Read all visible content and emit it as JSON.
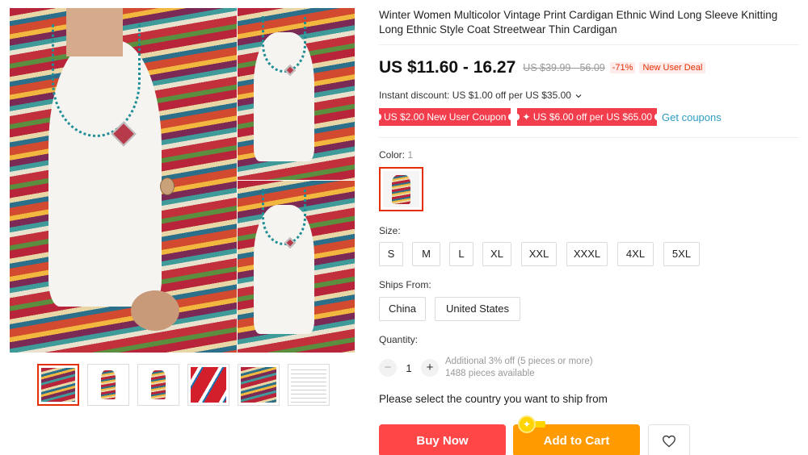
{
  "product": {
    "title": "Winter Women Multicolor Vintage Print Cardigan Ethnic Wind Long Sleeve Knitting Long Ethnic Style Coat Streetwear Thin Cardigan",
    "price": "US $11.60 - 16.27",
    "original_price": "US $39.99 - 56.09",
    "discount_percent": "-71%",
    "deal_badge": "New User Deal",
    "instant_discount": "Instant discount: US $1.00 off per US $35.00",
    "coupons": [
      "US $2.00 New User Coupon",
      "US $6.00 off per US $65.00"
    ],
    "get_coupons_label": "Get coupons"
  },
  "color": {
    "label": "Color:",
    "count": "1"
  },
  "size": {
    "label": "Size:",
    "options": [
      "S",
      "M",
      "L",
      "XL",
      "XXL",
      "XXXL",
      "4XL",
      "5XL"
    ]
  },
  "ships_from": {
    "label": "Ships From:",
    "options": [
      "China",
      "United States"
    ]
  },
  "quantity": {
    "label": "Quantity:",
    "minus": "−",
    "plus": "+",
    "value": "1",
    "bulk_note": "Additional 3% off (5 pieces or more)",
    "available": "1488 pieces available"
  },
  "ship_message": "Please select the country you want to ship from",
  "actions": {
    "buy_now": "Buy Now",
    "add_to_cart": "Add to Cart"
  },
  "icons": {
    "wishlist": "heart-icon",
    "promo": "sparkle-icon",
    "dropdown": "chevron-down-icon"
  },
  "colors": {
    "accent": "#ff4747",
    "cart": "#ff9a00",
    "link": "#2e9cc3",
    "coupon": "#f23d4c"
  }
}
